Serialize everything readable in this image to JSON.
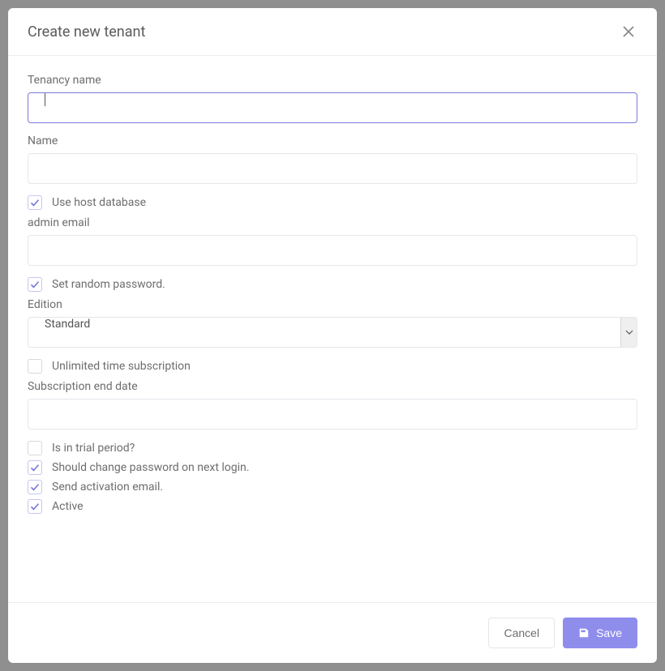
{
  "modal": {
    "title": "Create new tenant"
  },
  "form": {
    "tenancy_name_label": "Tenancy name",
    "tenancy_name_value": "",
    "name_label": "Name",
    "name_value": "",
    "use_host_db_label": "Use host database",
    "use_host_db_checked": true,
    "admin_email_label": "admin email",
    "admin_email_value": "",
    "set_random_password_label": "Set random password.",
    "set_random_password_checked": true,
    "edition_label": "Edition",
    "edition_value": "Standard",
    "unlimited_subscription_label": "Unlimited time subscription",
    "unlimited_subscription_checked": false,
    "subscription_end_label": "Subscription end date",
    "subscription_end_value": "",
    "trial_label": "Is in trial period?",
    "trial_checked": false,
    "change_pw_label": "Should change password on next login.",
    "change_pw_checked": true,
    "activation_email_label": "Send activation email.",
    "activation_email_checked": true,
    "active_label": "Active",
    "active_checked": true
  },
  "footer": {
    "cancel_label": "Cancel",
    "save_label": "Save"
  }
}
